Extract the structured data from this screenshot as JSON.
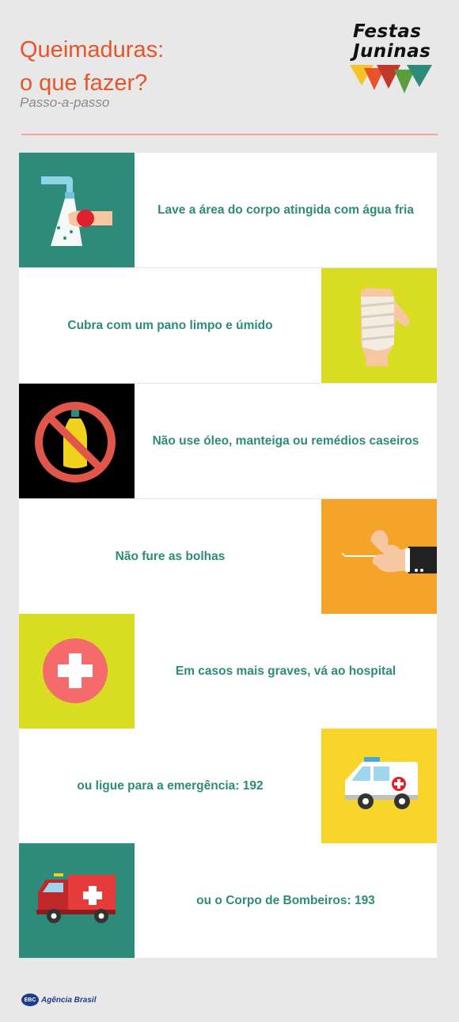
{
  "header": {
    "title_line1": "Queimaduras:",
    "title_line2": "o que fazer?",
    "subtitle": "Passo-a-passo"
  },
  "logo": {
    "line1": "Festas",
    "line2": "Juninas",
    "flag_colors": [
      "#f5c428",
      "#e8542a",
      "#c0392b",
      "#5a9e3c",
      "#2e8b79"
    ]
  },
  "steps": [
    {
      "text": "Lave a área do corpo atingida com água fria",
      "icon": "water-tap-hand-icon",
      "tile_color": "#2e8b79"
    },
    {
      "text": "Cubra com um pano limpo e úmido",
      "icon": "bandaged-hand-icon",
      "tile_color": "#d9dd22"
    },
    {
      "text": "Não use óleo, manteiga ou remédios caseiros",
      "icon": "no-oil-bottle-icon",
      "tile_color": "#000000"
    },
    {
      "text": "Não fure as bolhas",
      "icon": "hand-needle-icon",
      "tile_color": "#f5a42a"
    },
    {
      "text": "Em casos mais graves, vá ao hospital",
      "icon": "hospital-cross-icon",
      "tile_color": "#d9dd22"
    },
    {
      "text": "ou ligue para a emergência: 192",
      "icon": "ambulance-icon",
      "tile_color": "#f7d52b"
    },
    {
      "text": "ou o Corpo de Bombeiros: 193",
      "icon": "fire-truck-icon",
      "tile_color": "#2e8b79"
    }
  ],
  "footer": {
    "badge": "EBC",
    "text": "Agência Brasil"
  },
  "accent_color": "#e8542a",
  "text_color": "#2e8b79"
}
